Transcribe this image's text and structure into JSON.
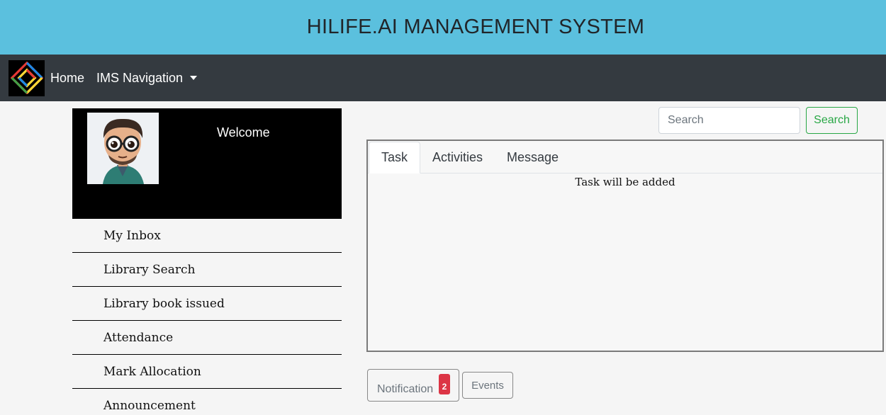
{
  "header": {
    "title": "HILIFE.AI MANAGEMENT SYSTEM"
  },
  "nav": {
    "logo_icon": "hilife-logo-icon",
    "home_label": "Home",
    "ims_label": "IMS Navigation"
  },
  "profile": {
    "welcome": "Welcome",
    "avatar_icon": "user-avatar"
  },
  "sidebar": {
    "items": [
      {
        "label": "My Inbox"
      },
      {
        "label": "Library Search"
      },
      {
        "label": "Library book issued"
      },
      {
        "label": "Attendance"
      },
      {
        "label": "Mark Allocation"
      },
      {
        "label": "Announcement"
      }
    ]
  },
  "search": {
    "placeholder": "Search",
    "button_label": "Search"
  },
  "tabs": {
    "items": [
      {
        "label": "Task",
        "active": true
      },
      {
        "label": "Activities",
        "active": false
      },
      {
        "label": "Message",
        "active": false
      }
    ],
    "content": "Task will be added"
  },
  "footer_buttons": {
    "notification_label": "Notification",
    "notification_count": "2",
    "events_label": "Events"
  },
  "colors": {
    "header_bg": "#5bc0de",
    "navbar_bg": "#343a40",
    "success": "#28a745",
    "danger": "#dc3545"
  }
}
